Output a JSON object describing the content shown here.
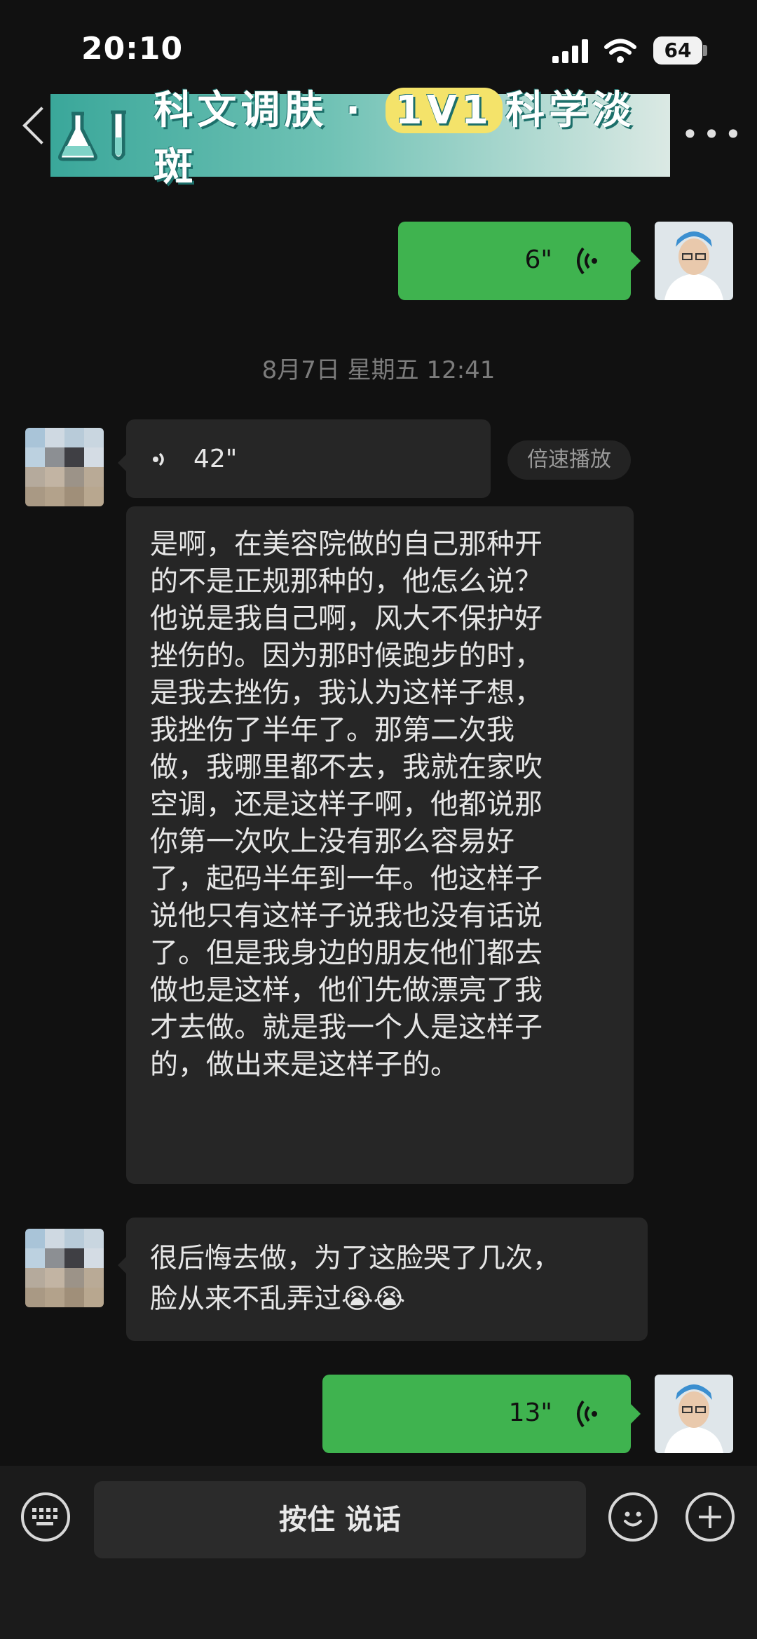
{
  "status_bar": {
    "time": "20:10",
    "battery": "64",
    "icons": [
      "signal-icon",
      "wifi-icon"
    ]
  },
  "header": {
    "banner_title_a": "科文调肤 · ",
    "banner_pill": "1V1",
    "banner_title_b": "科学淡斑",
    "icons": [
      "back-icon",
      "flask-icon",
      "test-tube-icon",
      "more-icon"
    ]
  },
  "messages": {
    "voice_1_duration": "6\"",
    "timestamp": "8月7日 星期五 12:41",
    "voice_2_duration": "42\"",
    "speed_play": "倍速播放",
    "transcript_lines": [
      "是啊，在美容院做的自己那种开",
      "的不是正规那种的，他怎么说？",
      "他说是我自己啊，风大不保护好",
      "挫伤的。因为那时候跑步的时，",
      "是我去挫伤，我认为这样子想，",
      "我挫伤了半年了。那第二次我",
      "做，我哪里都不去，我就在家吹",
      "空调，还是这样子啊，他都说那",
      "你第一次吹上没有那么容易好",
      "了，起码半年到一年。他这样子",
      "说他只有这样子说我也没有话说",
      "了。但是我身边的朋友他们都去",
      "做也是这样，他们先做漂亮了我",
      "才去做。就是我一个人是这样子",
      "的，做出来是这样子的。"
    ],
    "text_lines": [
      "很后悔去做，为了这脸哭了几次，",
      "脸从来不乱弄过😭😭"
    ],
    "voice_3_duration": "13\""
  },
  "bottom_bar": {
    "talk_label": "按住 说话",
    "icons": [
      "keyboard-icon",
      "emoji-icon",
      "plus-icon"
    ]
  },
  "colors": {
    "background": "#111111",
    "outgoing_bubble": "#3fb34f",
    "incoming_bubble": "#262626",
    "banner_teal": "#3aa79a"
  }
}
